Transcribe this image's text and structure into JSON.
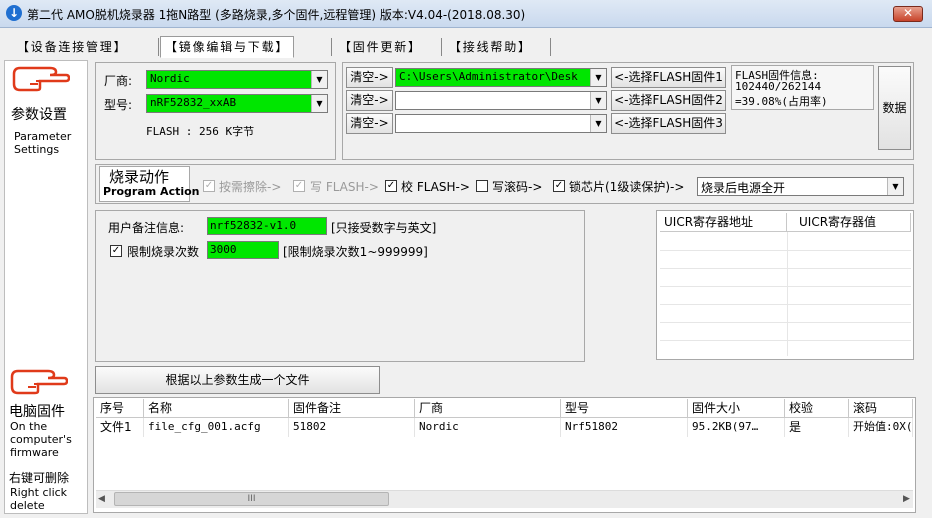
{
  "window": {
    "title": "第二代 AMO脱机烧录器 1拖N路型 (多路烧录,多个固件,远程管理)  版本:V4.04-(2018.08.30)",
    "close_label": "✕"
  },
  "tabs": [
    {
      "label": "【设备连接管理】"
    },
    {
      "label": "【镜像编辑与下载】"
    },
    {
      "label": "【固件更新】"
    },
    {
      "label": "【接线帮助】"
    }
  ],
  "sidebar": {
    "section1": {
      "cn": "参数设置",
      "en1": "Parameter",
      "en2": "Settings"
    },
    "section2": {
      "cn": "电脑固件",
      "en1": "On the",
      "en2": "computer's",
      "en3": "firmware"
    },
    "hint": {
      "cn": "右键可删除",
      "en1": "Right click",
      "en2": "delete"
    }
  },
  "chip": {
    "vendor_label": "厂商:",
    "vendor_value": "Nordic",
    "model_label": "型号:",
    "model_value": "nRF52832_xxAB",
    "flash_label": "FLASH  : 256 K字节"
  },
  "firmware": {
    "clear_label": "清空->",
    "path1": "C:\\Users\\Administrator\\Desk",
    "select1": "<-选择FLASH固件1",
    "select2": "<-选择FLASH固件2",
    "select3": "<-选择FLASH固件3",
    "info_title": "FLASH固件信息:",
    "info_size": "102440/262144",
    "info_ratio": "=39.08%(占用率)",
    "data_button": "数据"
  },
  "action": {
    "title_cn": "烧录动作",
    "title_en": "Program Action",
    "erase": "按需擦除->",
    "write": "写 FLASH->",
    "verify": "校 FLASH->",
    "serial": "写滚码->",
    "lock": "锁芯片(1级读保护)->",
    "after_value": "烧录后电源全开"
  },
  "settings": {
    "note_label": "用户备注信息:",
    "note_value": "nrf52832-v1.0",
    "note_hint": "[只接受数字与英文]",
    "limit_label": "限制烧录次数",
    "limit_value": "3000",
    "limit_hint": "[限制烧录次数1~999999]"
  },
  "uicr": {
    "col_addr": "UICR寄存器地址",
    "col_value": "UICR寄存器值"
  },
  "generate_button": "根据以上参数生成一个文件",
  "file_table": {
    "columns": [
      "序号",
      "名称",
      "固件备注",
      "厂商",
      "型号",
      "固件大小",
      "校验",
      "滚码"
    ],
    "rows": [
      [
        "文件1",
        "file_cfg_001.acfg",
        "51802",
        "Nordic",
        "Nrf51802",
        "95.2KB(97…",
        "是",
        "开始值:0X("
      ]
    ],
    "scroll_grip": "III"
  },
  "icons": {
    "check": "✓",
    "arrow_down": "▼",
    "arrow_left": "◀",
    "arrow_right": "▶"
  }
}
